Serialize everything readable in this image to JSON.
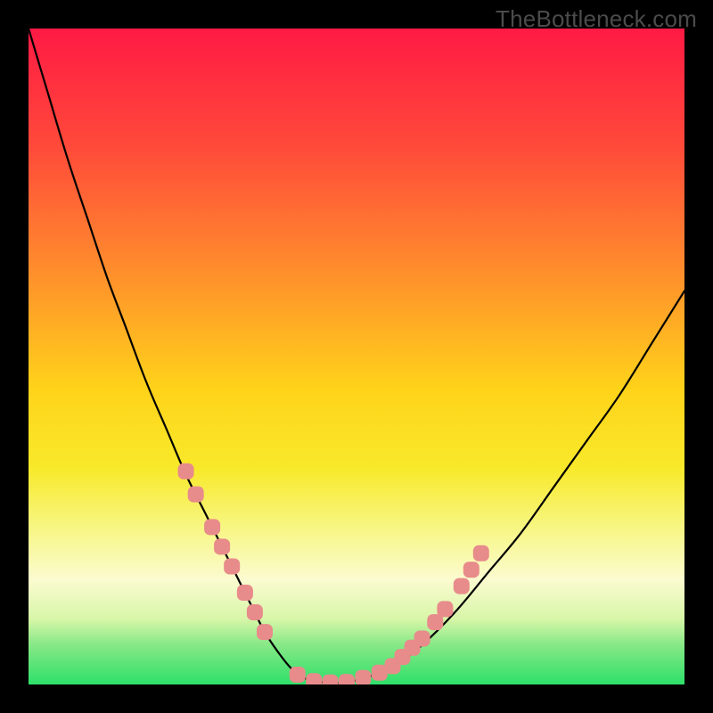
{
  "watermark": "TheBottleneck.com",
  "chart_data": {
    "type": "line",
    "title": "",
    "xlabel": "",
    "ylabel": "",
    "xlim": [
      0,
      100
    ],
    "ylim": [
      0,
      100
    ],
    "x": [
      0,
      3,
      6,
      9,
      12,
      15,
      18,
      21,
      24,
      27,
      30,
      32,
      34,
      36,
      38,
      40,
      42,
      45,
      48,
      52,
      56,
      60,
      65,
      70,
      75,
      80,
      85,
      90,
      95,
      100
    ],
    "values": [
      100,
      90,
      80,
      71,
      62,
      54,
      46,
      39,
      32,
      26,
      20,
      16,
      12,
      8,
      5,
      2.5,
      1,
      0.3,
      0.3,
      1.2,
      3,
      6,
      11,
      17,
      23,
      30,
      37,
      44,
      52,
      60
    ],
    "series": [
      {
        "name": "curve",
        "color": "#000000",
        "x": [
          0,
          3,
          6,
          9,
          12,
          15,
          18,
          21,
          24,
          27,
          30,
          32,
          34,
          36,
          38,
          40,
          42,
          45,
          48,
          52,
          56,
          60,
          65,
          70,
          75,
          80,
          85,
          90,
          95,
          100
        ],
        "values": [
          100,
          90,
          80,
          71,
          62,
          54,
          46,
          39,
          32,
          26,
          20,
          16,
          12,
          8,
          5,
          2.5,
          1,
          0.3,
          0.3,
          1.2,
          3,
          6,
          11,
          17,
          23,
          30,
          37,
          44,
          52,
          60
        ]
      }
    ],
    "markers": [
      {
        "x": 24.0,
        "y": 32.5
      },
      {
        "x": 25.5,
        "y": 29.0
      },
      {
        "x": 28.0,
        "y": 24.0
      },
      {
        "x": 29.5,
        "y": 21.0
      },
      {
        "x": 31.0,
        "y": 18.0
      },
      {
        "x": 33.0,
        "y": 14.0
      },
      {
        "x": 34.5,
        "y": 11.0
      },
      {
        "x": 36.0,
        "y": 8.0
      },
      {
        "x": 41.0,
        "y": 1.5
      },
      {
        "x": 43.5,
        "y": 0.5
      },
      {
        "x": 46.0,
        "y": 0.3
      },
      {
        "x": 48.5,
        "y": 0.4
      },
      {
        "x": 51.0,
        "y": 1.0
      },
      {
        "x": 53.5,
        "y": 1.8
      },
      {
        "x": 55.5,
        "y": 2.8
      },
      {
        "x": 57.0,
        "y": 4.2
      },
      {
        "x": 58.5,
        "y": 5.6
      },
      {
        "x": 60.0,
        "y": 7.0
      },
      {
        "x": 62.0,
        "y": 9.5
      },
      {
        "x": 63.5,
        "y": 11.5
      },
      {
        "x": 66.0,
        "y": 15.0
      },
      {
        "x": 67.5,
        "y": 17.5
      },
      {
        "x": 69.0,
        "y": 20.0
      }
    ],
    "marker_style": {
      "color": "#e88b8b",
      "size": 18,
      "shape": "rounded-rect"
    },
    "background": "rainbow-vertical-gradient"
  }
}
